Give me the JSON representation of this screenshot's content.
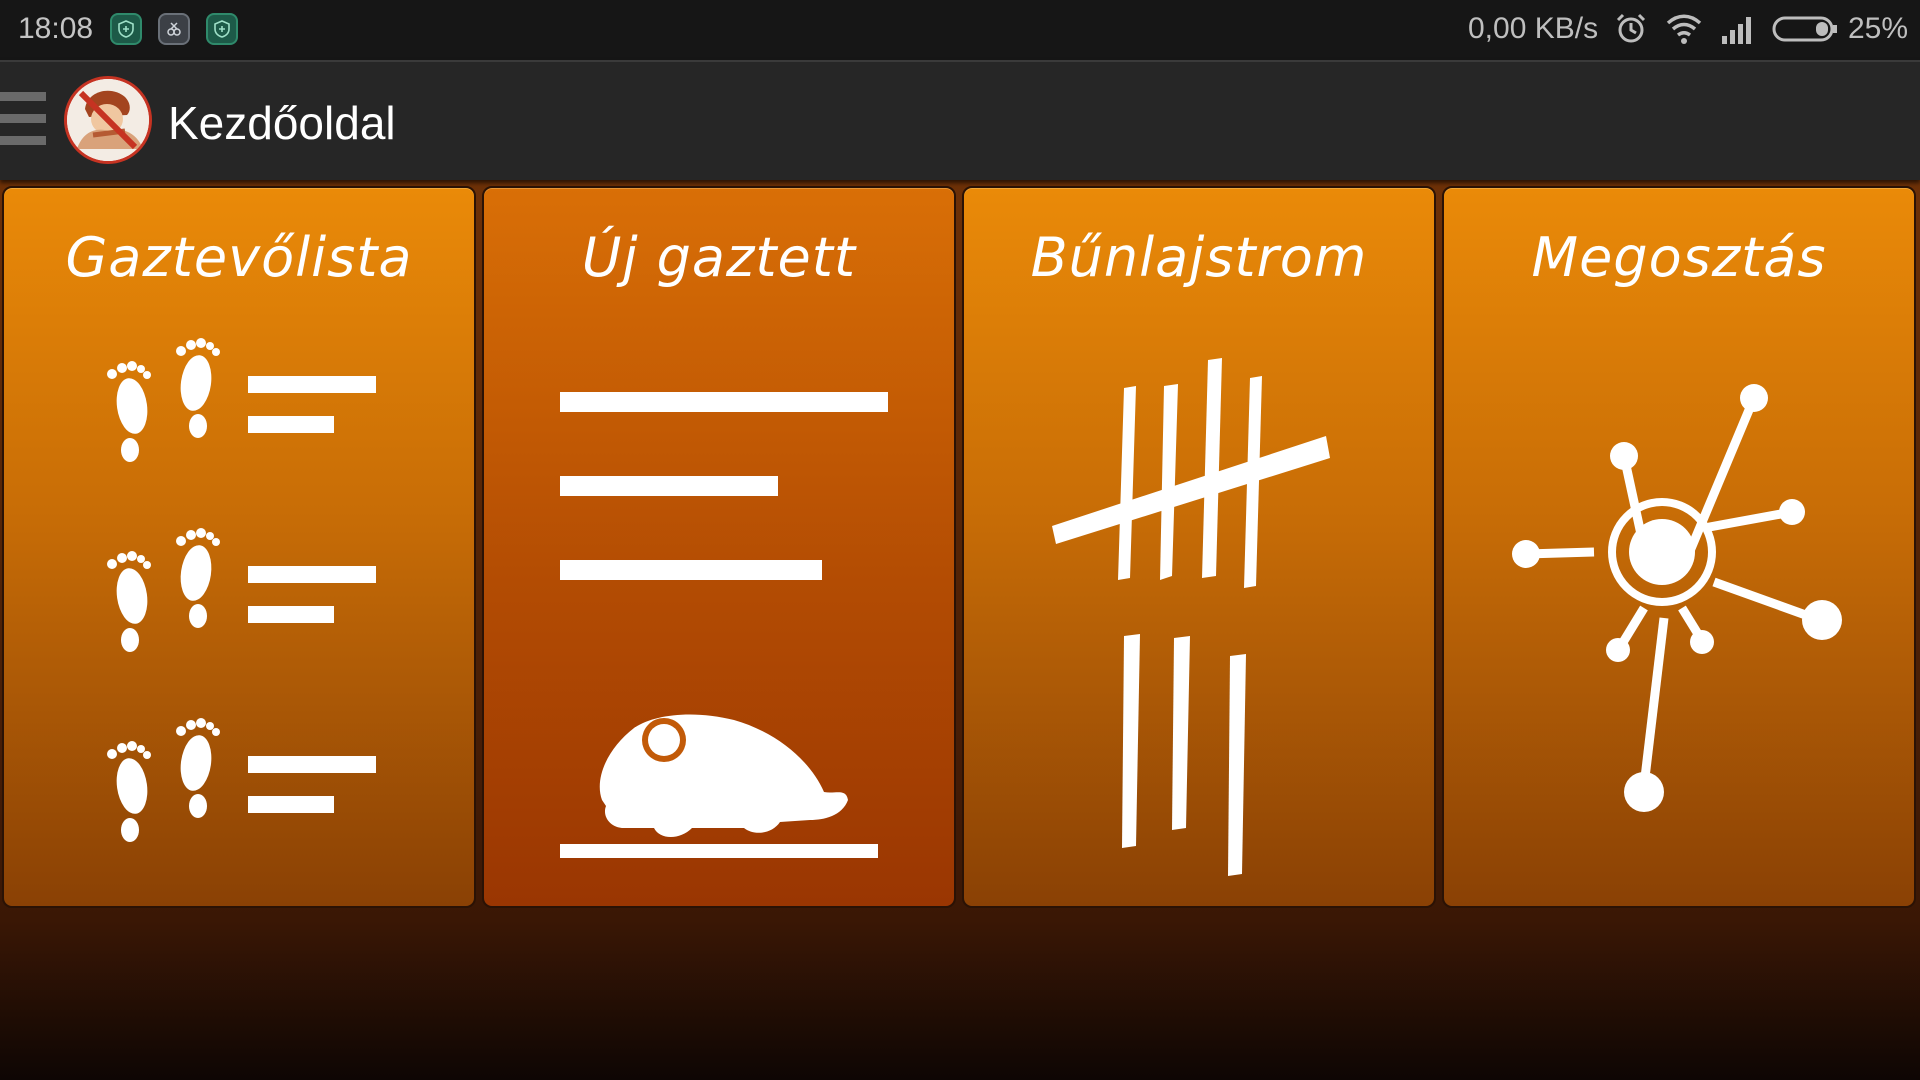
{
  "status_bar": {
    "time": "18:08",
    "notifications": [
      "shield-icon",
      "app-icon",
      "shield-icon"
    ],
    "network_speed": "0,00 KB/s",
    "battery_percent": "25%",
    "icons": [
      "alarm-icon",
      "wifi-icon",
      "signal-icon",
      "battery-icon"
    ]
  },
  "app_bar": {
    "title": "Kezdőoldal",
    "menu_icon": "hamburger-icon"
  },
  "tiles": [
    {
      "label": "Gaztevőlista",
      "icon": "footprints-list-icon"
    },
    {
      "label": "Új gaztett",
      "icon": "new-entry-mouse-icon"
    },
    {
      "label": "Bűnlajstrom",
      "icon": "tally-marks-icon"
    },
    {
      "label": "Megosztás",
      "icon": "share-network-icon"
    }
  ],
  "colors": {
    "tile_orange": "#ea8a08",
    "tile_active": "#b34c03",
    "app_bar": "#262626",
    "status_bar": "#161616"
  }
}
